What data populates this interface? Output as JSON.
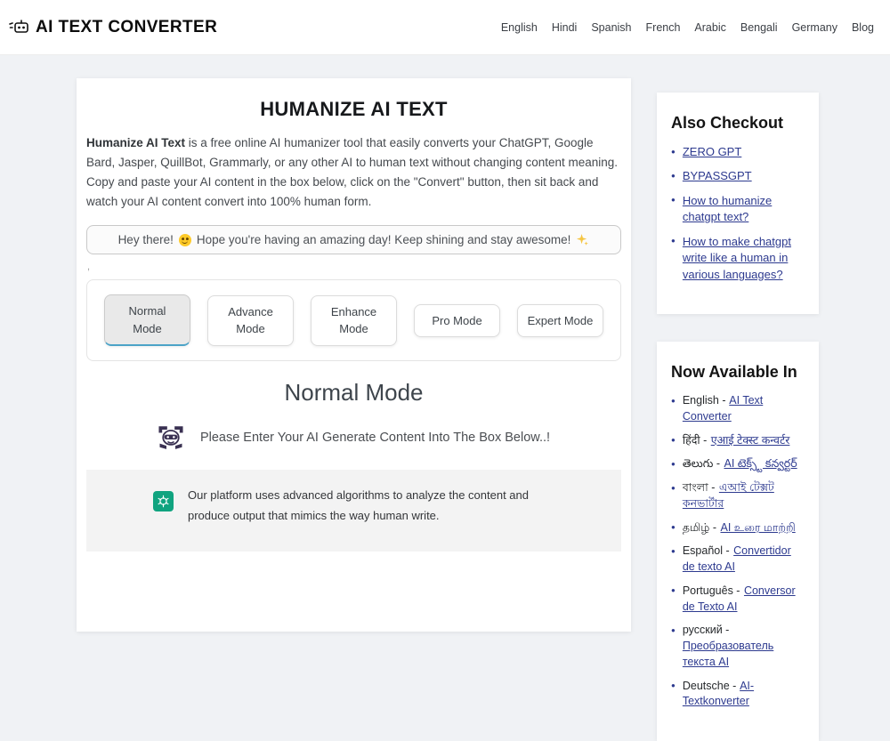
{
  "header": {
    "logo_text": "AI TEXT CONVERTER",
    "nav_links": [
      "English",
      "Hindi",
      "Spanish",
      "French",
      "Arabic",
      "Bengali",
      "Germany",
      "Blog"
    ]
  },
  "main": {
    "title": "HUMANIZE AI TEXT",
    "intro_lead": "Humanize AI Text",
    "intro_body": " is a free online AI humanizer tool that easily converts your ChatGPT, Google Bard, Jasper, QuillBot, Grammarly, or any other AI to human text without changing content meaning. Copy and paste your AI content in the box below, click on the \"Convert\" button, then sit back and watch your AI content convert into 100% human form.",
    "greeting": {
      "part1": "Hey there!",
      "smile_emoji": "😊",
      "part2": "Hope you're having an amazing day! Keep shining and stay awesome!",
      "sparkle_emoji": "✨"
    },
    "stray_mark": ",",
    "modes": [
      {
        "label": "Normal Mode",
        "active": true
      },
      {
        "label": "Advance Mode",
        "active": false
      },
      {
        "label": "Enhance Mode",
        "active": false
      },
      {
        "label": "Pro Mode",
        "active": false
      },
      {
        "label": "Expert Mode",
        "active": false
      }
    ],
    "mode_heading": "Normal Mode",
    "prompt_text": "Please Enter Your AI Generate Content Into The Box Below..!",
    "info_text": "Our platform uses advanced algorithms to analyze the content and produce output that mimics the way human write."
  },
  "sidebar": {
    "checkout": {
      "title": "Also Checkout",
      "links": [
        "ZERO GPT",
        "BYPASSGPT",
        "How to humanize chatgpt text?",
        "How to make chatgpt write like a human in various languages?"
      ]
    },
    "available": {
      "title": "Now Available In",
      "items": [
        {
          "label": "English -",
          "link": "AI Text Converter"
        },
        {
          "label": "हिंदी -",
          "link": "एआई टेक्स्ट कन्वर्टर"
        },
        {
          "label": "తెలుగు -",
          "link": "AI టెక్స్ట్ కన్వర్టర్"
        },
        {
          "label": "বাংলা -",
          "link": "এআই টেক্সট কনভার্টার"
        },
        {
          "label": "தமிழ் -",
          "link": "AI உரை மாற்றி"
        },
        {
          "label": "Español -",
          "link": "Convertidor de texto AI"
        },
        {
          "label": "Português -",
          "link": "Conversor de Texto AI"
        },
        {
          "label": "русский -",
          "link": "Преобразователь текста AI"
        },
        {
          "label": "Deutsche -",
          "link": "AI-Textkonverter"
        }
      ]
    }
  },
  "colors": {
    "accent_blue": "#4ba3c7",
    "link_navy": "#2d3a8f",
    "chatgpt_green": "#10a37f",
    "page_bg": "#f0f2f5"
  }
}
